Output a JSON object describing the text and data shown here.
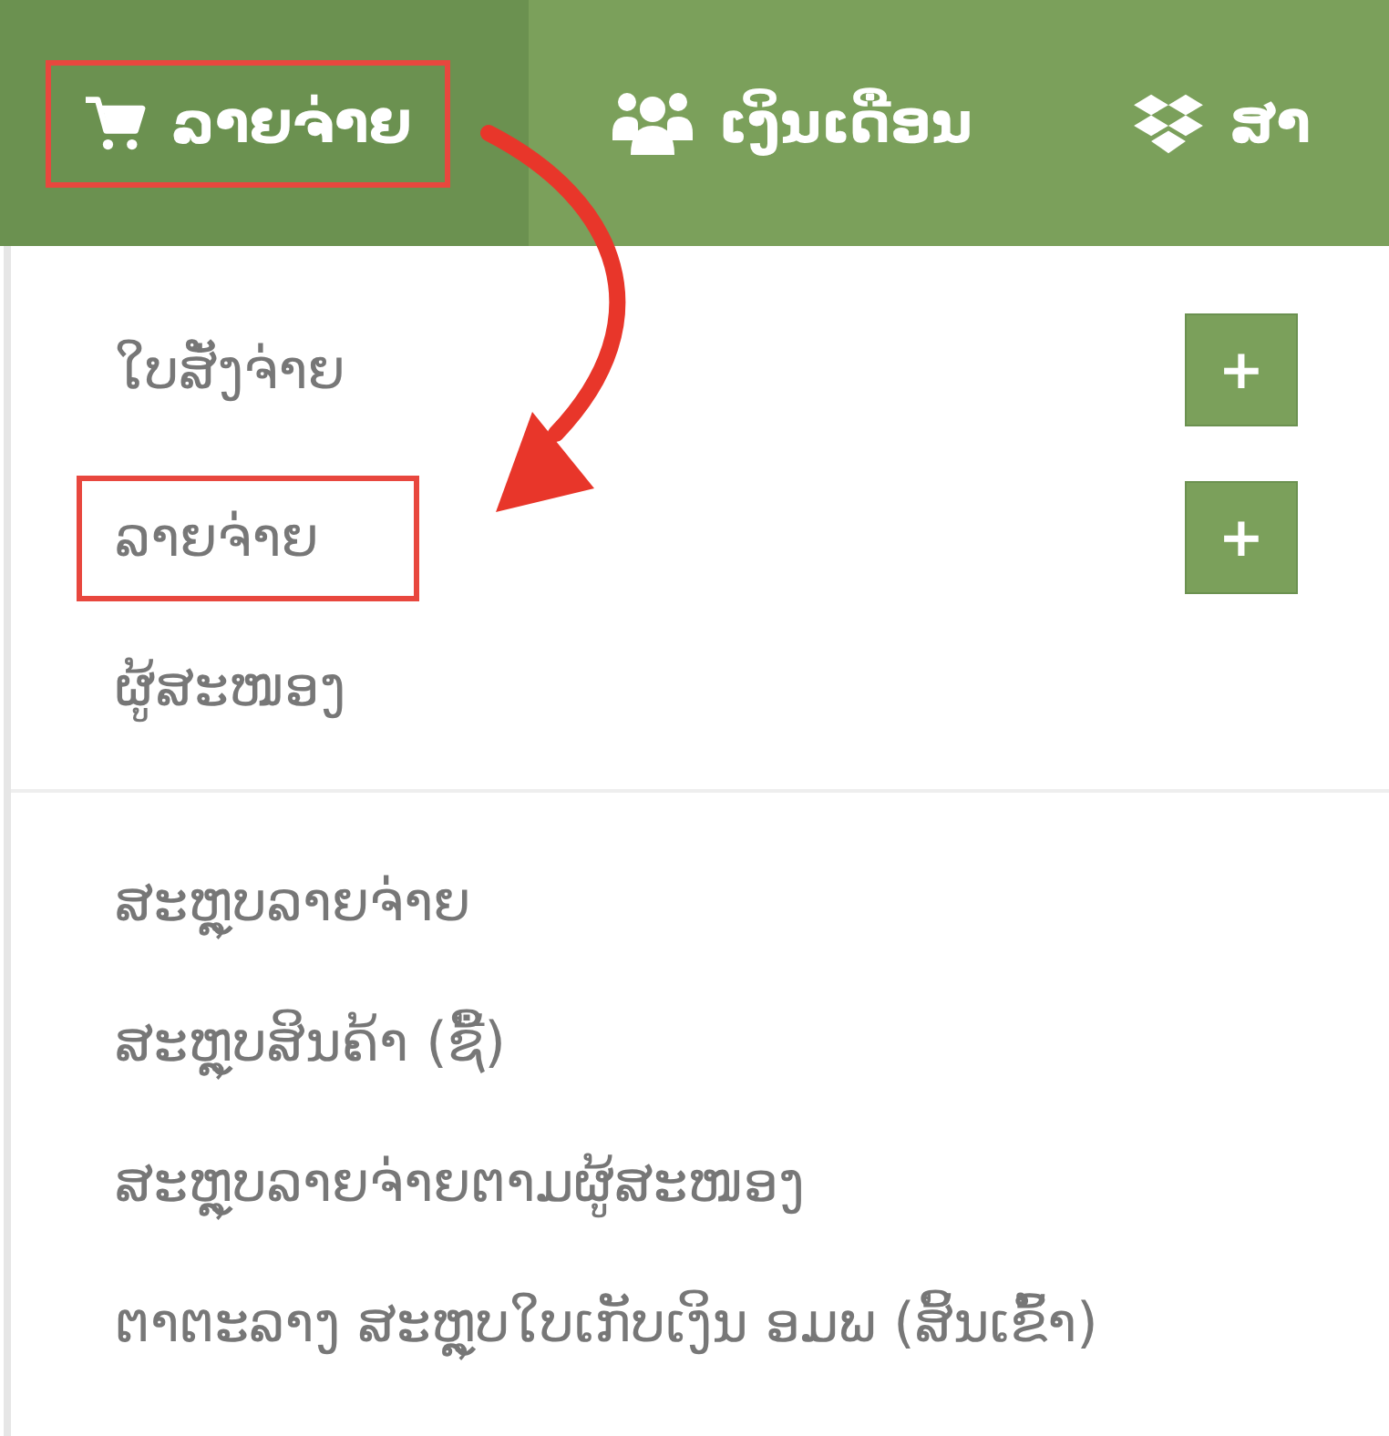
{
  "nav": {
    "tabs": [
      {
        "label": "ລາຍຈ່າຍ",
        "selected": true,
        "highlighted": true
      },
      {
        "label": "ເງິນເດືອນ",
        "selected": false,
        "highlighted": false
      },
      {
        "label": "ສາ",
        "selected": false,
        "highlighted": false
      }
    ]
  },
  "menu": {
    "groups": [
      {
        "items": [
          {
            "label": "ໃບສັ່ງຈ່າຍ",
            "add_button": "+",
            "highlighted": false
          },
          {
            "label": "ລາຍຈ່າຍ",
            "add_button": "+",
            "highlighted": true
          },
          {
            "label": "ຜູ້ສະໜອງ",
            "highlighted": false
          }
        ]
      },
      {
        "items": [
          {
            "label": "ສະຫຼຸບລາຍຈ່າຍ",
            "highlighted": false
          },
          {
            "label": "ສະຫຼຸບສິນຄ້າ (ຊື້)",
            "highlighted": false
          },
          {
            "label": "ສະຫຼຸບລາຍຈ່າຍຕາມຜູ້ສະໜອງ",
            "highlighted": false
          },
          {
            "label": "ຕາຕະລາງ ສະຫຼຸບໃບເກັບເງິນ ອມພ (ສິ້ນເຂົ້າ)",
            "highlighted": false
          }
        ]
      }
    ]
  },
  "annotation": {
    "arrow": true
  }
}
